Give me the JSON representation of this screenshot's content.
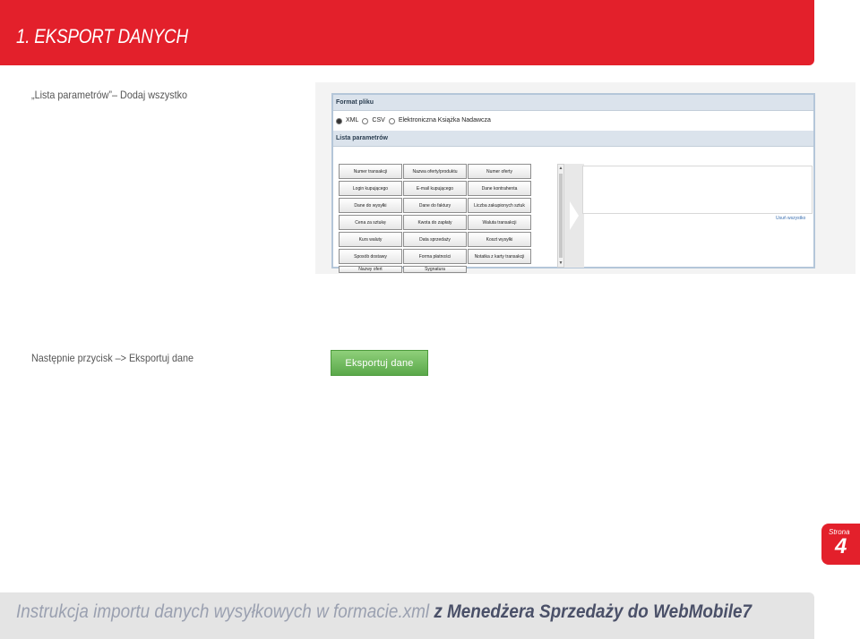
{
  "header": {
    "title": "1. EKSPORT DANYCH"
  },
  "steps": {
    "step1": "„Lista parametrów”– Dodaj wszystko",
    "step2": "Następnie przycisk –> Eksportuj dane"
  },
  "screenshot": {
    "format_header": "Format pliku",
    "formats": [
      {
        "label": "XML",
        "selected": true
      },
      {
        "label": "CSV",
        "selected": false
      },
      {
        "label": "Elektroniczna Książka Nadawcza",
        "selected": false
      }
    ],
    "params_header": "Lista parametrów",
    "param_buttons": [
      "Numer transakcji",
      "Nazwa oferty/produktu",
      "Numer oferty",
      "Login kupującego",
      "E-mail kupującego",
      "Dane kontrahenta",
      "Dane do wysyłki",
      "Dane do faktury",
      "Liczba zakupionych sztuk",
      "Cena za sztukę",
      "Kwota do zapłaty",
      "Waluta transakcji",
      "Kurs waluty",
      "Data sprzedaży",
      "Koszt wysyłki",
      "Sposób dostawy",
      "Forma płatności",
      "Notatka z karty transakcji",
      "Nazwy ofert",
      "Sygnatura"
    ],
    "remove_all": "Usuń wszystko"
  },
  "export_button": {
    "label": "Eksportuj dane"
  },
  "page_tag": {
    "label": "Strona",
    "number": "4"
  },
  "footer": {
    "light_text": "Instrukcja importu danych wysyłkowych w formacie.xml",
    "bold_text": "z Menedżera Sprzedaży do WebMobile7"
  },
  "colors": {
    "brand_red": "#e3202b",
    "export_green": "#6cbc58",
    "footer_gray": "#e4e4e4"
  }
}
